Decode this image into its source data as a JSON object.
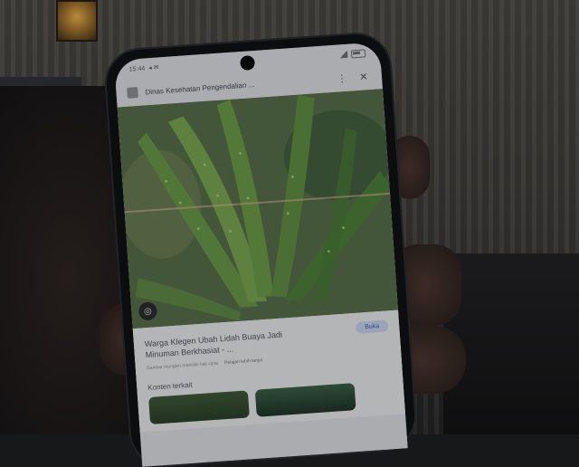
{
  "status_bar": {
    "time": "15:44"
  },
  "header": {
    "site_name": "Dinas Kesehatan Pengendalian ...",
    "menu_icon": "more-vertical-icon",
    "close_icon": "close-icon"
  },
  "image": {
    "subject": "aloe-vera-plant",
    "lens_icon": "lens-icon"
  },
  "result": {
    "title": "Warga Klegen Ubah Lidah Buaya Jadi Minuman Berkhasiat - ...",
    "visit_label": "Buka",
    "meta_text": "Gambar mungkin memiliki hak cipta.",
    "meta_label": "Pelajari lebih lanjut"
  },
  "related": {
    "label": "Konten terkait"
  },
  "colors": {
    "accent": "#3a5fa8",
    "plant": "#6e9a4c"
  }
}
